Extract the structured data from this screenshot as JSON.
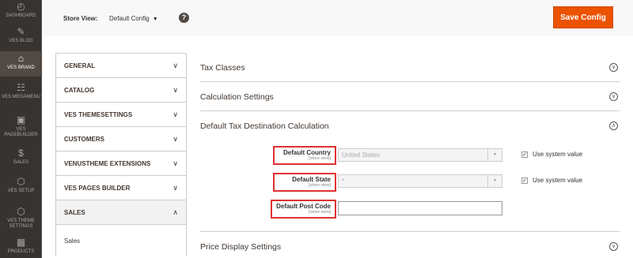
{
  "admin_nav": {
    "items": [
      {
        "label": "DASHBOARD",
        "icon": "dashboard-icon",
        "glyph": "◴"
      },
      {
        "label": "VES BLOG",
        "icon": "pencil-icon",
        "glyph": "✎"
      },
      {
        "label": "VES BRAND",
        "icon": "store-icon",
        "glyph": "⌂",
        "active": true
      },
      {
        "label": "VES MEGAMENU",
        "icon": "grid-icon",
        "glyph": "☷"
      },
      {
        "label": "VES PAGEBUILDER",
        "icon": "pagebuilder-icon",
        "glyph": "▣"
      },
      {
        "label": "SALES",
        "icon": "dollar-icon",
        "glyph": "$"
      },
      {
        "label": "VES SETUP",
        "icon": "hexagon-icon",
        "glyph": "⬡"
      },
      {
        "label": "VES THEME SETTINGS",
        "icon": "hexagon-icon",
        "glyph": "⬡"
      },
      {
        "label": "PRODUCTS",
        "icon": "box-icon",
        "glyph": "▦"
      }
    ]
  },
  "header": {
    "store_view_label": "Store View:",
    "store_view_value": "Default Config",
    "help_glyph": "?",
    "save_label": "Save Config"
  },
  "tabs": {
    "items": [
      {
        "label": "GENERAL",
        "chev": "∨"
      },
      {
        "label": "CATALOG",
        "chev": "∨"
      },
      {
        "label": "VES THEMESETTINGS",
        "chev": "∨"
      },
      {
        "label": "CUSTOMERS",
        "chev": "∨"
      },
      {
        "label": "VENUSTHEME EXTENSIONS",
        "chev": "∨"
      },
      {
        "label": "VES PAGES BUILDER",
        "chev": "∨"
      },
      {
        "label": "SALES",
        "chev": "∧"
      }
    ],
    "sub_item": "Sales"
  },
  "sections": {
    "tax_classes": "Tax Classes",
    "calculation_settings": "Calculation Settings",
    "default_tax_destination": "Default Tax Destination Calculation",
    "price_display": "Price Display Settings",
    "collapsed_toggle": "∨",
    "expanded_toggle": "∧"
  },
  "fields": {
    "country": {
      "label": "Default Country",
      "scope": "[store view]",
      "value": "United States"
    },
    "state": {
      "label": "Default State",
      "scope": "[store view]",
      "value": "*"
    },
    "postcode": {
      "label": "Default Post Code",
      "scope": "[store view]",
      "value": ""
    },
    "use_system_value": "Use system value",
    "check_glyph": "✓",
    "select_arrow": "▾"
  },
  "colors": {
    "accent": "#eb5202",
    "highlight_border": "#e03232",
    "nav_bg": "#373330"
  }
}
